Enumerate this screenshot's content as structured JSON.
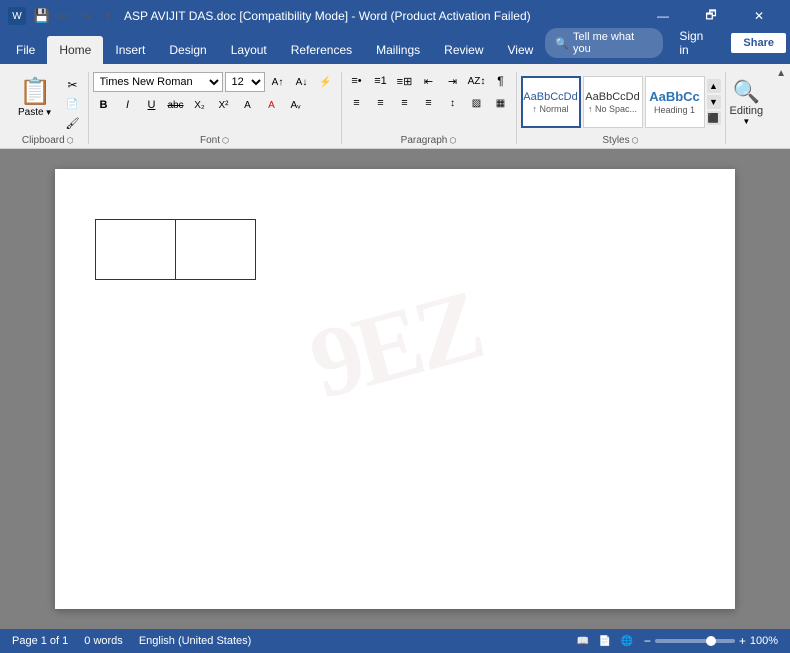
{
  "titlebar": {
    "title": "ASP AVIJIT DAS.doc [Compatibility Mode] - Word (Product Activation Failed)",
    "save_icon": "💾",
    "undo_icon": "↩",
    "redo_icon": "↪",
    "minimize": "—",
    "restore": "🗗",
    "close": "✕"
  },
  "menutabs": {
    "tabs": [
      "File",
      "Home",
      "Insert",
      "Design",
      "Layout",
      "References",
      "Mailings",
      "Review",
      "View"
    ],
    "active": "Home",
    "tell_me": "Tell me what you",
    "sign_in": "Sign in",
    "share": "Share"
  },
  "ribbon": {
    "clipboard": {
      "label": "Clipboard",
      "paste_label": "Paste",
      "paste_icon": "📋",
      "cut_icon": "✂",
      "copy_icon": "📄",
      "format_painter_icon": "🖌"
    },
    "font": {
      "label": "Font",
      "font_name": "Times New Roman",
      "font_size": "12",
      "bold": "B",
      "italic": "I",
      "underline": "U",
      "strikethrough": "abc",
      "subscript": "X₂",
      "superscript": "X²",
      "highlight": "A"
    },
    "paragraph": {
      "label": "Paragraph"
    },
    "styles": {
      "label": "Styles",
      "items": [
        {
          "id": "normal",
          "preview": "AaBbCcDd",
          "label": "↑ Normal",
          "active": true
        },
        {
          "id": "no-spacing",
          "preview": "AaBbCcDd",
          "label": "↑ No Spac..."
        },
        {
          "id": "heading1",
          "preview": "AaBbCc",
          "label": "Heading 1"
        }
      ]
    },
    "editing": {
      "label": "Editing",
      "icon": "🔍"
    }
  },
  "document": {
    "watermark": "9EZ",
    "table": {
      "rows": 1,
      "cols": 2
    }
  },
  "statusbar": {
    "page": "Page 1 of 1",
    "words": "0 words",
    "language": "English (United States)",
    "zoom": "100%"
  }
}
